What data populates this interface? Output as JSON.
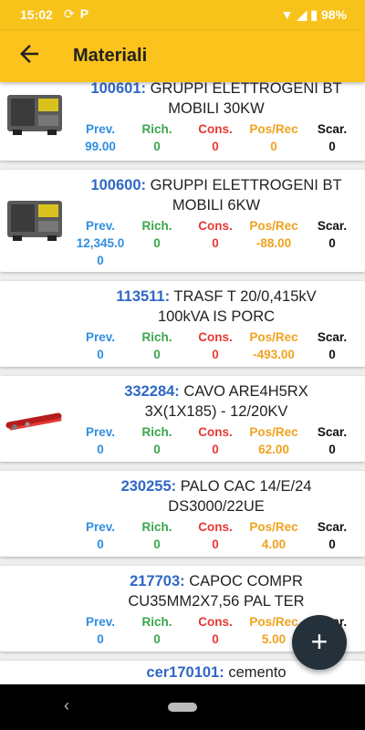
{
  "status_bar": {
    "time": "15:02",
    "battery": "98%",
    "icons": [
      "sync-icon",
      "parking-icon",
      "wifi-icon",
      "signal-icon",
      "battery-icon"
    ]
  },
  "app_bar": {
    "title": "Materiali",
    "back_icon": "arrow-back-icon"
  },
  "labels": {
    "prev": "Prev.",
    "rich": "Rich.",
    "cons": "Cons.",
    "pos": "Pos/Rec",
    "scar": "Scar."
  },
  "items": [
    {
      "code": "100601:",
      "name_line1": "GRUPPI ELETTROGENI BT",
      "name_line2": "MOBILI 30KW",
      "prev": "99.00",
      "rich": "0",
      "cons": "0",
      "pos": "0",
      "scar": "0",
      "image": "generator-icon"
    },
    {
      "code": "100600:",
      "name_line1": "GRUPPI ELETTROGENI BT",
      "name_line2": "MOBILI 6KW",
      "prev": "12,345.0",
      "prev2": "0",
      "rich": "0",
      "cons": "0",
      "pos": "-88.00",
      "scar": "0",
      "image": "generator-icon"
    },
    {
      "code": "113511:",
      "name_line1": "TRASF T 20/0,415kV",
      "name_line2": "100kVA IS PORC",
      "prev": "0",
      "rich": "0",
      "cons": "0",
      "pos": "-493.00",
      "scar": "0"
    },
    {
      "code": "332284:",
      "name_line1": "CAVO ARE4H5RX",
      "name_line2": "3X(1X185) - 12/20KV",
      "prev": "0",
      "rich": "0",
      "cons": "0",
      "pos": "62.00",
      "scar": "0",
      "image": "cable-icon"
    },
    {
      "code": "230255:",
      "name_line1": "PALO CAC 14/E/24",
      "name_line2": "DS3000/22UE",
      "prev": "0",
      "rich": "0",
      "cons": "0",
      "pos": "4.00",
      "scar": "0"
    },
    {
      "code": "217703:",
      "name_line1": "CAPOC COMPR",
      "name_line2": "CU35MM2X7,56 PAL TER",
      "prev": "0",
      "rich": "0",
      "cons": "0",
      "pos": "5.00",
      "scar": "0"
    },
    {
      "code": "cer170101:",
      "name_line1": "cemento"
    }
  ],
  "fab": {
    "label": "+"
  },
  "nav": {
    "back": "‹"
  }
}
